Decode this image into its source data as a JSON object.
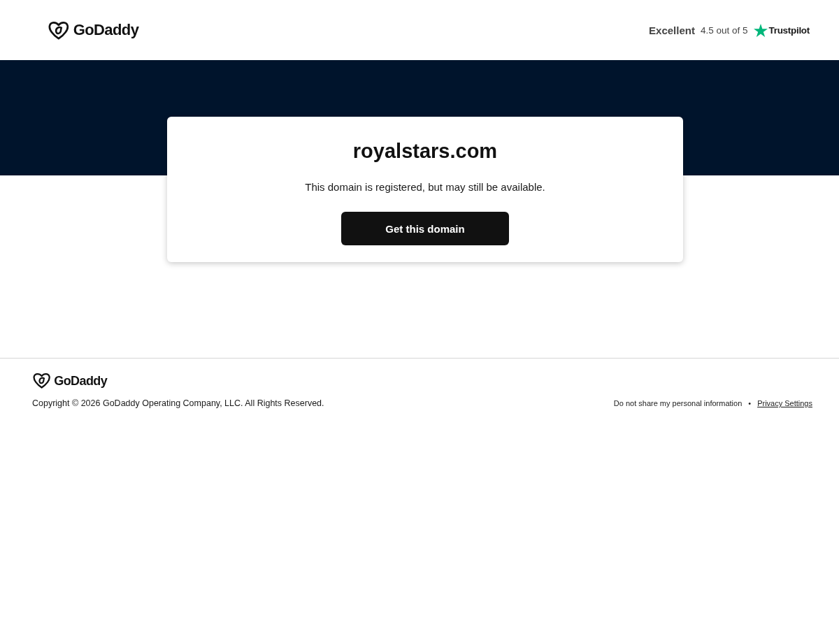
{
  "header": {
    "logo_text": "GoDaddy",
    "rating": {
      "label": "Excellent",
      "score": "4.5 out of 5",
      "brand": "Trustpilot"
    }
  },
  "hero": {
    "domain": "royalstars.com",
    "message": "This domain is registered, but may still be available.",
    "button": "Get this domain"
  },
  "footer": {
    "logo_text": "GoDaddy",
    "copyright": "Copyright © 2026 GoDaddy Operating Company, LLC. All Rights Reserved.",
    "links": [
      {
        "label": "Do not share my personal information",
        "underlined": false
      },
      {
        "label": "Privacy Settings",
        "underlined": true
      }
    ],
    "separator": "•"
  }
}
